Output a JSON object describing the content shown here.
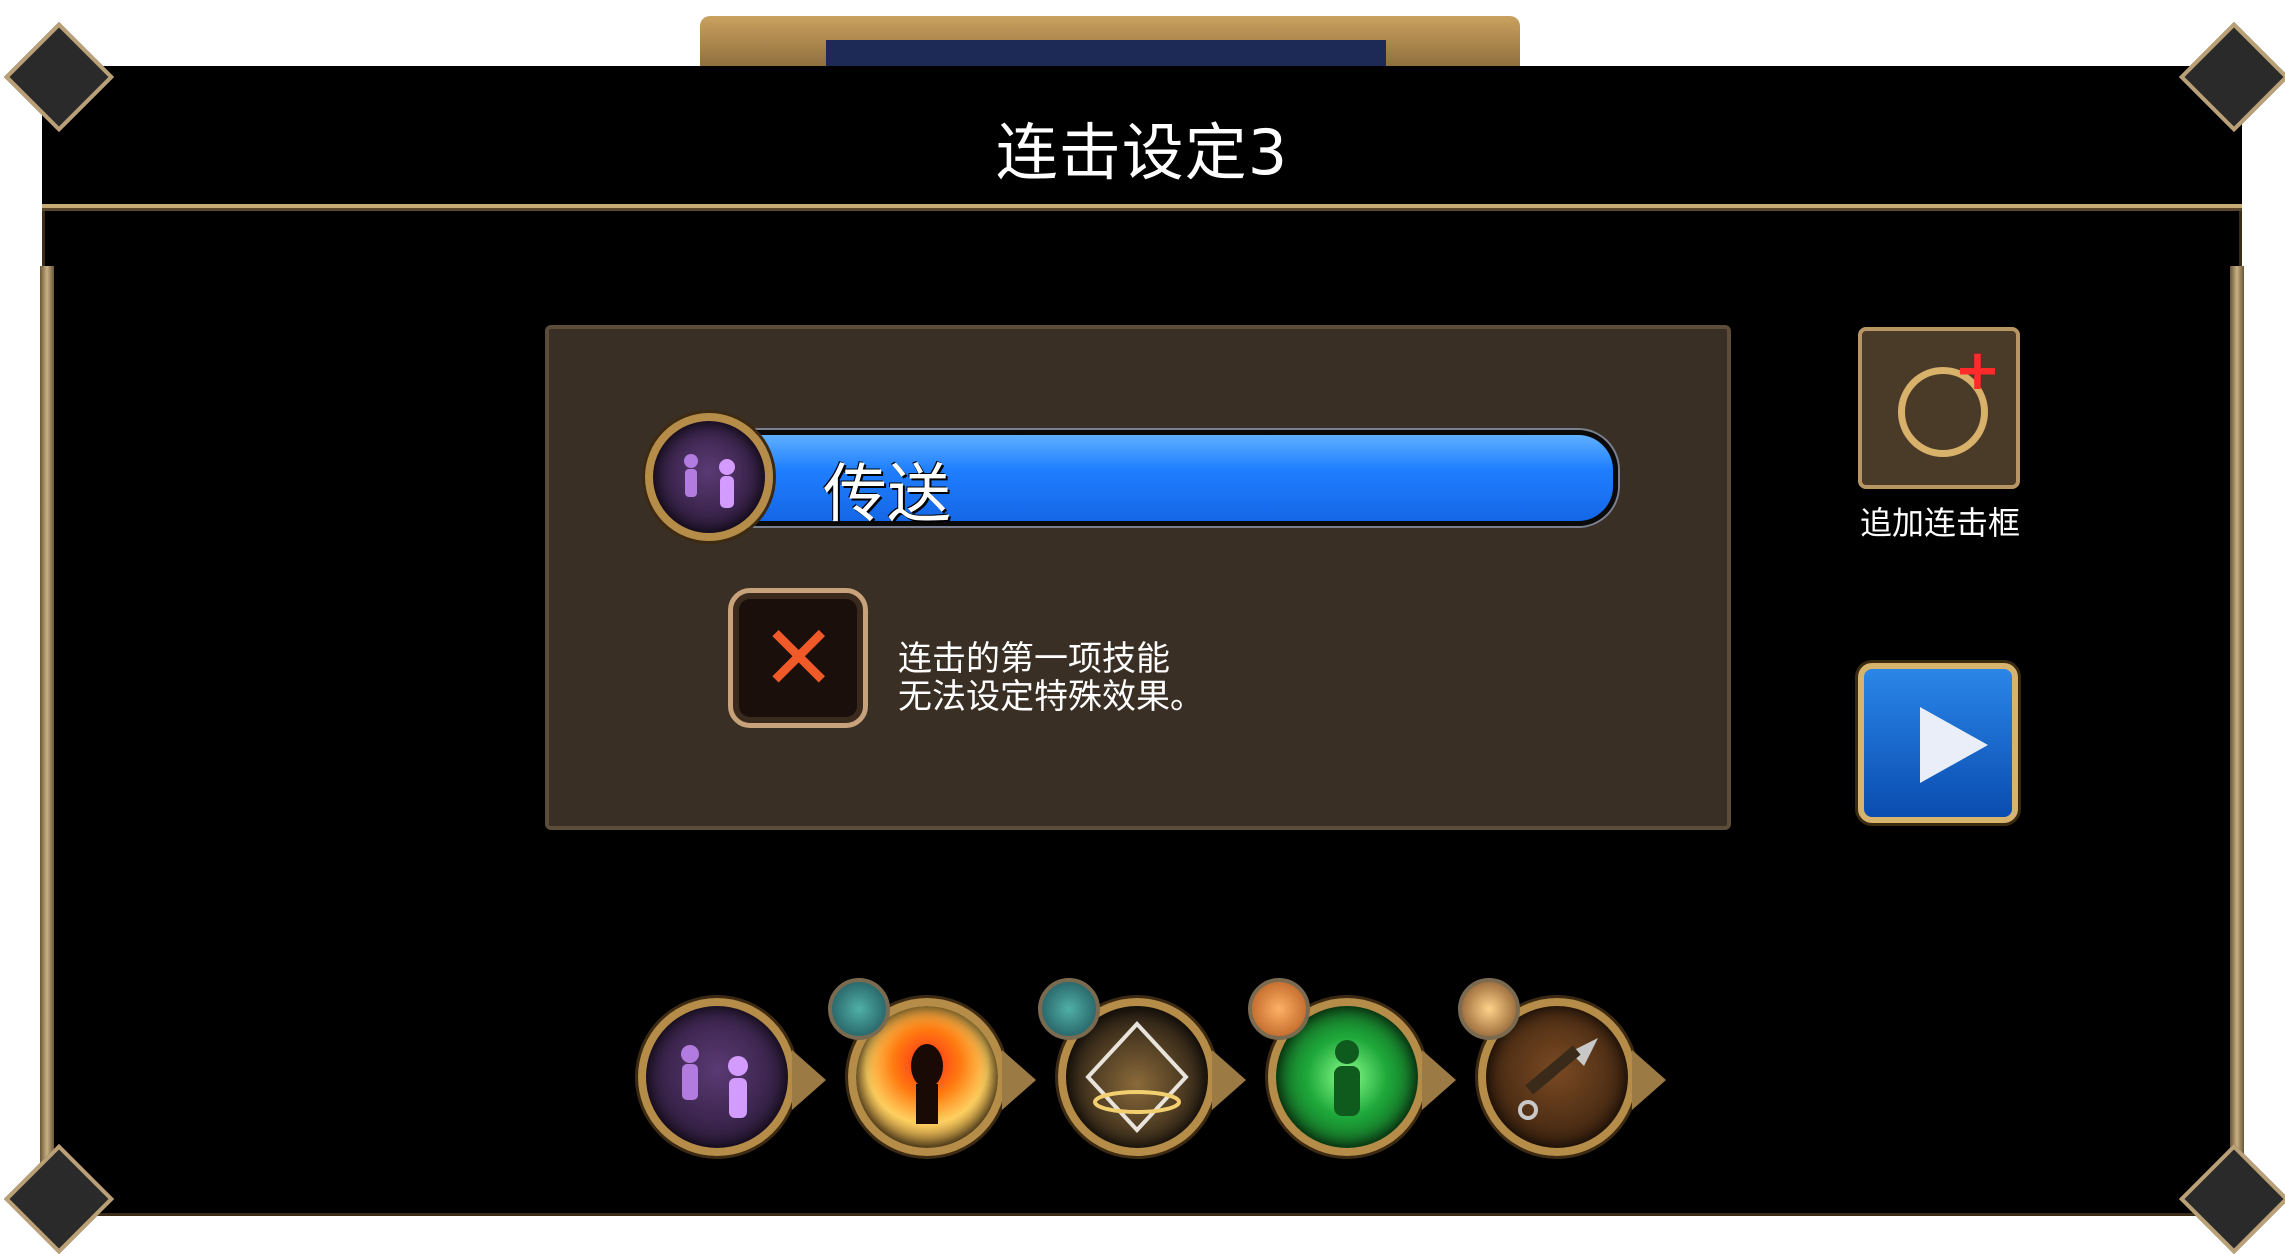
{
  "header": {
    "title": "连击设定3"
  },
  "combo_slot": {
    "skill_name": "传送",
    "notice_line1": "连击的第一项技能",
    "notice_line2": "无法设定特殊效果。"
  },
  "side": {
    "add_label": "追加连击框"
  },
  "skills": [
    {
      "icon": "teleport-icon"
    },
    {
      "icon": "shadow-burst-icon",
      "badge": "pet-badge"
    },
    {
      "icon": "ring-shield-icon",
      "badge": "pet-badge"
    },
    {
      "icon": "green-aura-icon",
      "badge": "strength-badge"
    },
    {
      "icon": "kunai-icon",
      "badge": "speed-badge"
    }
  ],
  "colors": {
    "skill_bar": "#1f7fff",
    "gold_frame": "#b58c48",
    "panel_bg": "#3a2f24",
    "x_mark": "#f05a28",
    "add_plus": "#ff2a2a"
  }
}
